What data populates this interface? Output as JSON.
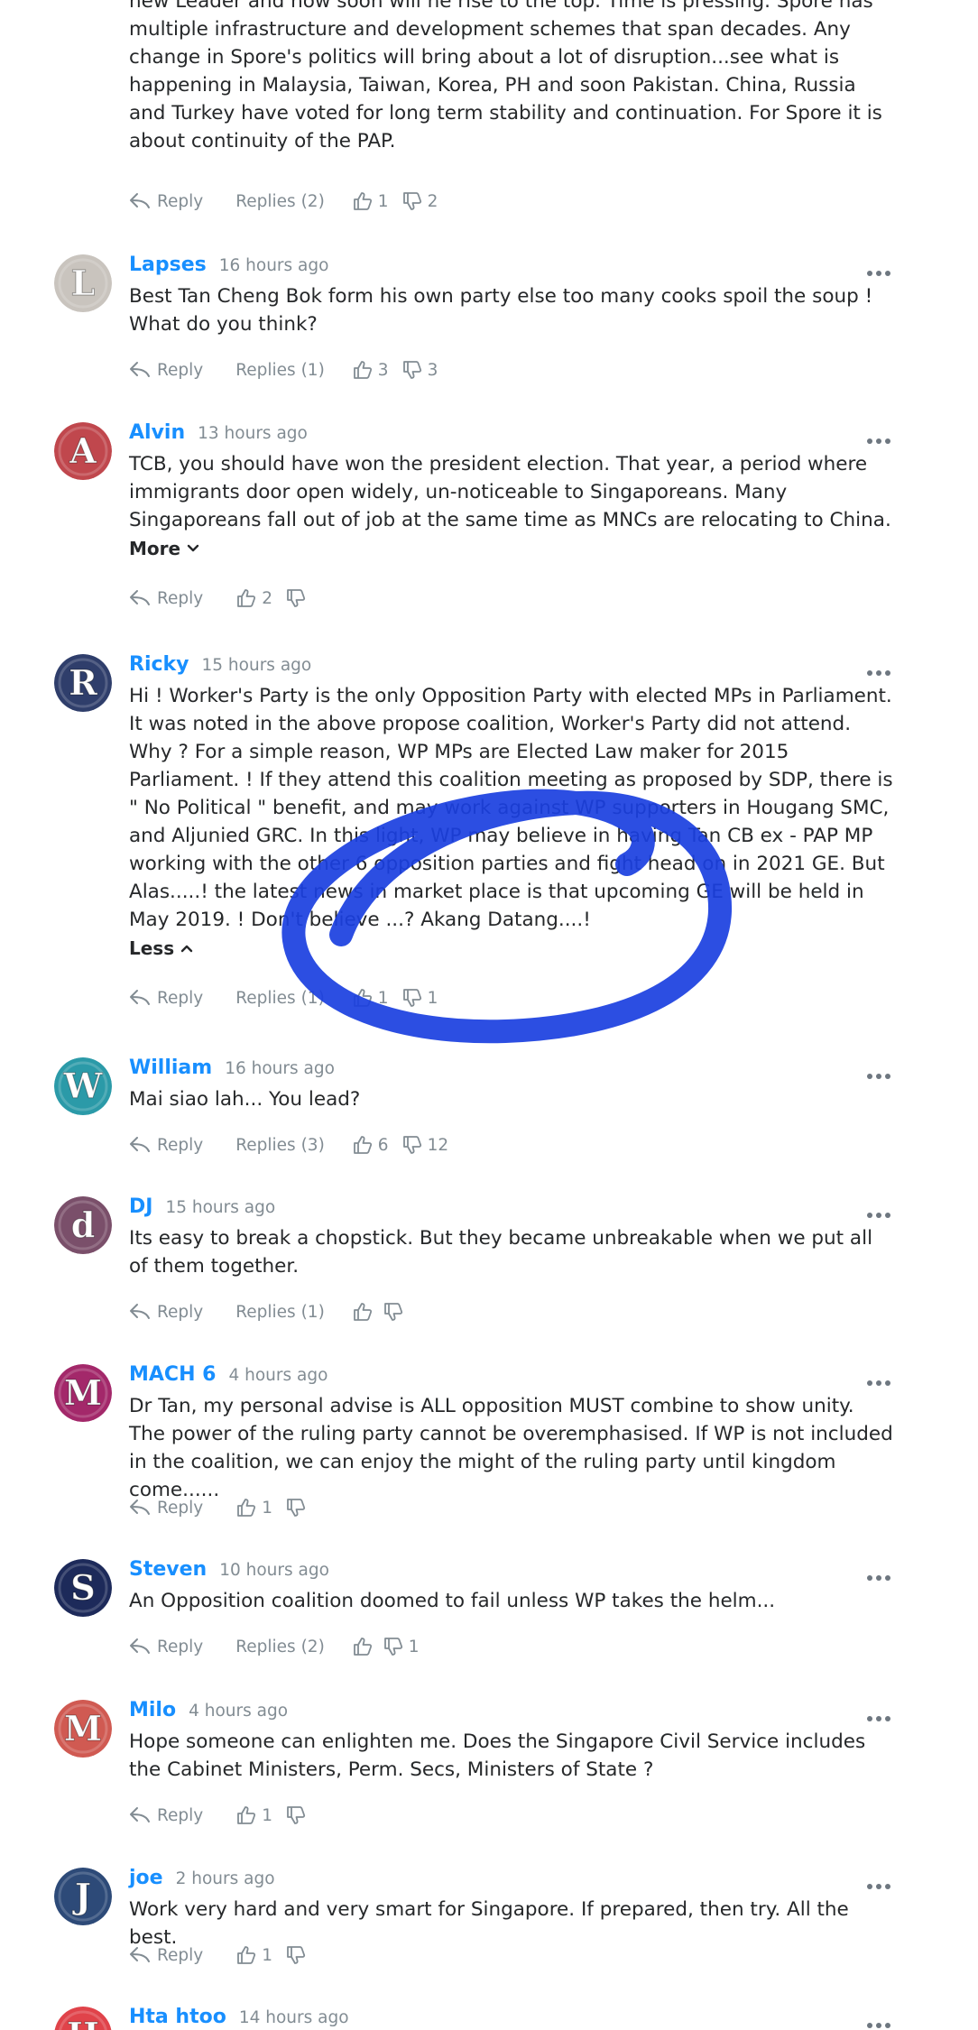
{
  "top_comment": {
    "text": "new Leader and how soon will he rise to the top. Time is pressing. Spore has multiple infrastructure and development schemes that span decades. Any change in Spore's politics will bring about a lot of disruption...see what is happening in Malaysia, Taiwan, Korea, PH and soon Pakistan. China, Russia and Turkey have voted for long term stability and continuation. For Spore it is about continuity of the PAP.",
    "reply_label": "Reply",
    "replies_label": "Replies (2)",
    "likes": "1",
    "dislikes": "2"
  },
  "comments": [
    {
      "author": "Lapses",
      "time": "16 hours ago",
      "text": "Best Tan Cheng Bok form his own party else too many cooks spoil the soup ! What do you think?",
      "reply_label": "Reply",
      "replies_label": "Replies (1)",
      "likes": "3",
      "dislikes": "3",
      "avatar_letter": "L",
      "avatar_color": "#c9c4be"
    },
    {
      "author": "Alvin",
      "time": "13 hours ago",
      "text": "TCB, you should have won the president election. That year, a period where immigrants door open widely, un-noticeable to Singaporeans. Many Singaporeans fall out of job at the same time as MNCs are relocating to China.",
      "toggle_label": "More",
      "reply_label": "Reply",
      "likes": "2",
      "dislikes": "",
      "avatar_letter": "A",
      "avatar_color": "#c0474d"
    },
    {
      "author": "Ricky",
      "time": "15 hours ago",
      "text": "Hi ! Worker's Party is the only Opposition Party with elected MPs in Parliament. It was noted in the above propose coalition, Worker's Party did not attend. Why ? For a simple reason, WP MPs are Elected Law maker for 2015 Parliament. ! If they attend this coalition meeting as proposed by SDP, there is \" No Political \" benefit, and may work against WP supporters in Hougang SMC, and Aljunied GRC. In this light, WP may believe in having Tan CB ex - PAP MP working with the other 6 opposition parties and fight head on in 2021 GE. But Alas.....! the latest news in market place is that upcoming GE will be held in May 2019. ! Don't believe ...? Akang Datang....!",
      "toggle_label": "Less",
      "reply_label": "Reply",
      "replies_label": "Replies (1)",
      "likes": "1",
      "dislikes": "1",
      "avatar_letter": "R",
      "avatar_color": "#2f3e6b"
    },
    {
      "author": "William",
      "time": "16 hours ago",
      "text": "Mai siao lah... You lead?",
      "reply_label": "Reply",
      "replies_label": "Replies (3)",
      "likes": "6",
      "dislikes": "12",
      "avatar_letter": "W",
      "avatar_color": "#2b9aa8"
    },
    {
      "author": "DJ",
      "time": "15 hours ago",
      "text": "Its easy to break a chopstick. But they became unbreakable when we put all of them together.",
      "reply_label": "Reply",
      "replies_label": "Replies (1)",
      "likes": "",
      "dislikes": "",
      "avatar_letter": "d",
      "avatar_color": "#7a4f6a"
    },
    {
      "author": "MACH 6",
      "time": "4 hours ago",
      "text": "Dr Tan, my personal advise is ALL opposition MUST combine to show unity. The power of the ruling party cannot be overemphasised. If WP is not included in the coalition, we can enjoy the might of the ruling party until kingdom come......",
      "reply_label": "Reply",
      "likes": "1",
      "dislikes": "",
      "avatar_letter": "M",
      "avatar_color": "#a3286a"
    },
    {
      "author": "Steven",
      "time": "10 hours ago",
      "text": "An Opposition coalition doomed to fail unless WP takes the helm...",
      "reply_label": "Reply",
      "replies_label": "Replies (2)",
      "likes": "",
      "dislikes": "1",
      "avatar_letter": "S",
      "avatar_color": "#1d2a5a"
    },
    {
      "author": "Milo",
      "time": "4 hours ago",
      "text": "Hope someone can enlighten me. Does the Singapore Civil Service includes the Cabinet Ministers, Perm. Secs, Ministers of State ?",
      "reply_label": "Reply",
      "likes": "1",
      "dislikes": "",
      "avatar_letter": "M",
      "avatar_color": "#d05a52"
    },
    {
      "author": "joe",
      "time": "2 hours ago",
      "text": "Work very hard and very smart for Singapore. If prepared, then try. All the best.",
      "reply_label": "Reply",
      "likes": "1",
      "dislikes": "",
      "avatar_letter": "J",
      "avatar_color": "#2d4a78"
    },
    {
      "author": "Hta htoo",
      "time": "14 hours ago",
      "avatar_letter": "H",
      "avatar_color": "#e0434a"
    }
  ],
  "annotation_color": "#1a3fe0"
}
